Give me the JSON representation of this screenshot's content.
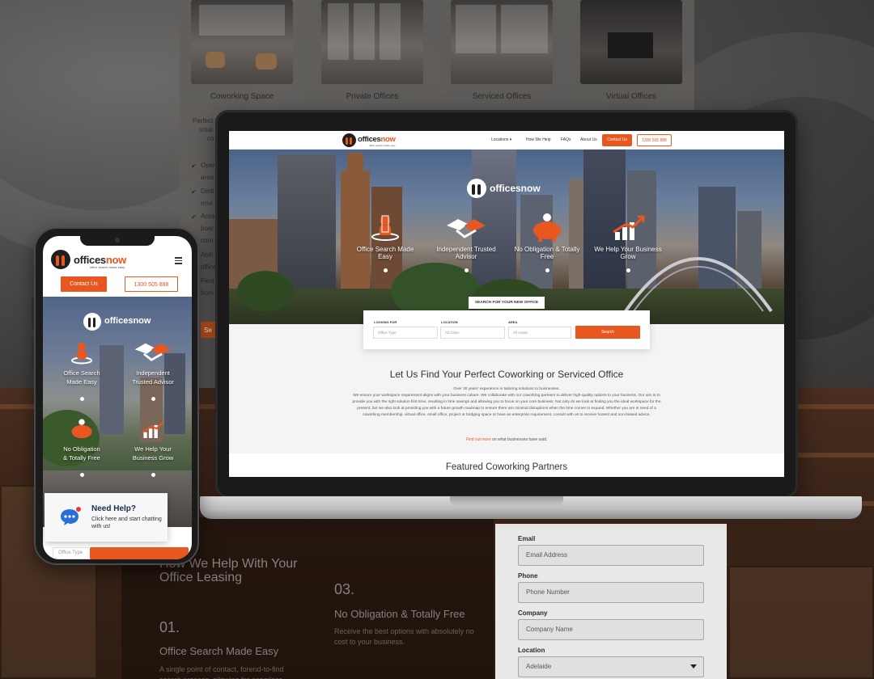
{
  "background": {
    "cards": [
      {
        "label": "Coworking Space"
      },
      {
        "label": "Private Offices"
      },
      {
        "label": "Serviced Offices"
      },
      {
        "label": "Virtual Offices"
      }
    ],
    "left_text": [
      "Perfect f",
      "smal",
      "co"
    ],
    "checklist": [
      "Oper",
      "area",
      "Dedi",
      "envi",
      "Acce",
      "boar",
      "com",
      "Abili",
      "office",
      "Flexi",
      "from"
    ],
    "button_fragment": "Se",
    "lower_heading": "How We Help With Your Office Leasing",
    "step_01_number": "01.",
    "step_01_title": "Office Search Made Easy",
    "step_01_text": "A single point of contact, forend-to-find search process, allowing for seamless",
    "step_03_number": "03.",
    "step_03_title": "No Obligation & Totally Free",
    "step_03_text": "Receive the best options with absolutely no cost to your business.",
    "form": {
      "email_label": "Email",
      "email_placeholder": "Email Address",
      "phone_label": "Phone",
      "phone_placeholder": "Phone Number",
      "company_label": "Company",
      "company_placeholder": "Company Name",
      "location_label": "Location",
      "location_value": "Adelaide"
    }
  },
  "brand": {
    "name_part1": "offices",
    "name_part2": "now",
    "tagline": "office search made easy",
    "accent_color": "#e8571f"
  },
  "desktop": {
    "nav": {
      "locations": "Locations",
      "how_we_help": "How We Help",
      "faqs": "FAQs",
      "about_us": "About Us",
      "contact_us": "Contact Us",
      "phone": "1300 505 888"
    },
    "hero": {
      "logo_text": "officesnow",
      "features": [
        {
          "title": "Office Search Made Easy",
          "icon": "person-search-icon"
        },
        {
          "title": "Independent Trusted Advisor",
          "icon": "handshake-icon"
        },
        {
          "title": "No Obligation & Totally Free",
          "icon": "piggy-bank-icon"
        },
        {
          "title": "We Help Your Business Grow",
          "icon": "growth-chart-icon"
        }
      ]
    },
    "search": {
      "tab_label": "SEARCH FOR YOUR NEW OFFICE",
      "looking_for_label": "LOOKING FOR",
      "looking_for_value": "Office Type",
      "location_label": "LOCATION",
      "location_value": "All Cities",
      "area_label": "AREA",
      "area_value": "All Areas",
      "button": "Search"
    },
    "intro": {
      "title": "Let Us Find Your Perfect Coworking or Serviced Office",
      "line1": "Over 30 years' experience in tailoring solutions to businesses.",
      "body": "We ensure your workspace requirement aligns with your business culture. We collaborate with our coworking partners to deliver high-quality options to your business. Our aim is to provide you with the right solution first time, resulting in time savings and allowing you to focus on your core business. Not only do we look at finding you the ideal workspace for the present, but we also look at providing you with a future growth roadmap to ensure there are minimal disruptions when the time comes to expand. Whether you are in need of a coworking membership, virtual office, small office, project or bridging space or have an enterprise requirement, consult with us to receive honest and non-biased advice.",
      "link_text": "Find out more",
      "link_suffix": "on what businesses have said."
    },
    "partners_title": "Featured Coworking Partners"
  },
  "mobile": {
    "contact_us": "Contact Us",
    "phone": "1300 505 888",
    "hero_logo_text": "officesnow",
    "features": [
      {
        "title_line1": "Office Search",
        "title_line2": "Made Easy"
      },
      {
        "title_line1": "Independent",
        "title_line2": "Trusted Advisor"
      },
      {
        "title_line1": "No Obligation",
        "title_line2": "& Totally Free"
      },
      {
        "title_line1": "We Help Your",
        "title_line2": "Business Grow"
      }
    ],
    "chat": {
      "title": "Need Help?",
      "subtitle": "Click here and start chatting with us!"
    },
    "office_type": "Office Type"
  }
}
